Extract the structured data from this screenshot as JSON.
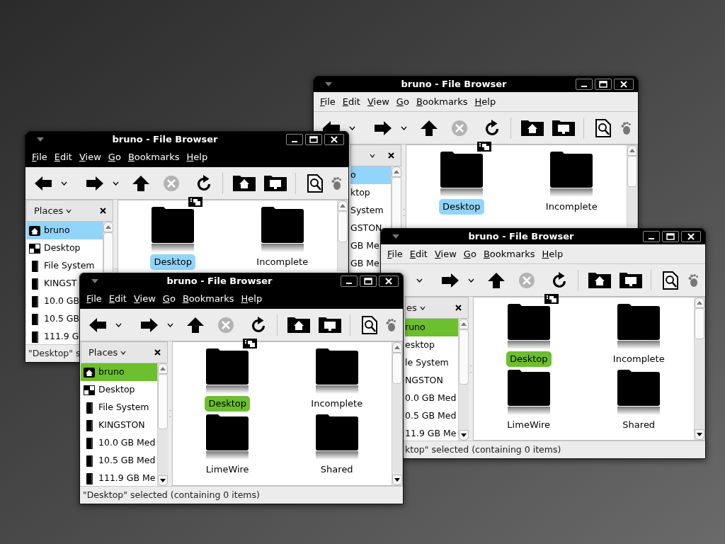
{
  "windows": [
    {
      "title": "bruno - File Browser",
      "kind": "light",
      "color": "#92d5fb",
      "menus": [
        "File",
        "Edit",
        "View",
        "Go",
        "Bookmarks",
        "Help"
      ],
      "sidebar": {
        "items": [
          {
            "label": "o",
            "selected": true
          },
          {
            "label": "ktop",
            "selected": false
          },
          {
            "label": "System",
            "selected": false
          },
          {
            "label": "GSTON",
            "selected": false
          },
          {
            "label": "GB Me",
            "selected": false
          },
          {
            "label": "GB Me",
            "selected": false
          }
        ]
      },
      "files": [
        {
          "label": "Desktop",
          "selected": true,
          "emblem": true
        },
        {
          "label": "Incomplete",
          "selected": false,
          "emblem": false
        }
      ]
    },
    {
      "title": "bruno - File Browser",
      "kind": "dark",
      "color": "#92d5fb",
      "menus": [
        "File",
        "Edit",
        "View",
        "Go",
        "Bookmarks",
        "Help"
      ],
      "sidebar": {
        "header": "Places",
        "items": [
          {
            "label": "bruno",
            "kind": "home",
            "selected": true
          },
          {
            "label": "Desktop",
            "kind": "desktop",
            "selected": false
          },
          {
            "label": "File System",
            "kind": "drive",
            "selected": false
          },
          {
            "label": "KINGST",
            "kind": "drive",
            "selected": false
          },
          {
            "label": "10.0 GB",
            "kind": "drive",
            "selected": false
          },
          {
            "label": "10.5 GB",
            "kind": "drive",
            "selected": false
          },
          {
            "label": "111.9 G",
            "kind": "drive",
            "selected": false
          }
        ]
      },
      "files": [
        {
          "label": "Desktop",
          "selected": true,
          "emblem": true
        },
        {
          "label": "Incomplete",
          "selected": false,
          "emblem": false
        }
      ],
      "status": "\"Desktop\" s"
    },
    {
      "title": "bruno - File Browser",
      "kind": "light",
      "color": "#6cbf2f",
      "menus": [
        "File",
        "Edit",
        "View",
        "Go",
        "Bookmarks",
        "Help"
      ],
      "sidebar": {
        "header": "es",
        "items": [
          {
            "label": "runo",
            "selected": true
          },
          {
            "label": "esktop",
            "selected": false
          },
          {
            "label": "le System",
            "selected": false
          },
          {
            "label": "NGSTON",
            "selected": false
          },
          {
            "label": "0.0 GB Med",
            "selected": false
          },
          {
            "label": "0.5 GB Med",
            "selected": false
          },
          {
            "label": "11.9 GB Me",
            "selected": false
          }
        ]
      },
      "files": [
        {
          "label": "Desktop",
          "selected": true,
          "emblem": true
        },
        {
          "label": "Incomplete",
          "selected": false,
          "emblem": false
        },
        {
          "label": "LimeWire",
          "selected": false,
          "emblem": false
        },
        {
          "label": "Shared",
          "selected": false,
          "emblem": false
        }
      ],
      "status": "ktop\" selected (containing 0 items)"
    },
    {
      "title": "bruno - File Browser",
      "kind": "dark",
      "color": "#6cbf2f",
      "menus": [
        "File",
        "Edit",
        "View",
        "Go",
        "Bookmarks",
        "Help"
      ],
      "sidebar": {
        "header": "Places",
        "items": [
          {
            "label": "bruno",
            "kind": "home",
            "selected": true
          },
          {
            "label": "Desktop",
            "kind": "desktop",
            "selected": false
          },
          {
            "label": "File System",
            "kind": "drive",
            "selected": false
          },
          {
            "label": "KINGSTON",
            "kind": "drive",
            "selected": false
          },
          {
            "label": "10.0 GB Med",
            "kind": "drive",
            "selected": false
          },
          {
            "label": "10.5 GB Med",
            "kind": "drive",
            "selected": false
          },
          {
            "label": "111.9 GB Me",
            "kind": "drive",
            "selected": false
          }
        ]
      },
      "files": [
        {
          "label": "Desktop",
          "selected": true,
          "emblem": true
        },
        {
          "label": "Incomplete",
          "selected": false,
          "emblem": false
        },
        {
          "label": "LimeWire",
          "selected": false,
          "emblem": false
        },
        {
          "label": "Shared",
          "selected": false,
          "emblem": false
        }
      ],
      "status": "\"Desktop\" selected (containing 0 items)"
    }
  ]
}
